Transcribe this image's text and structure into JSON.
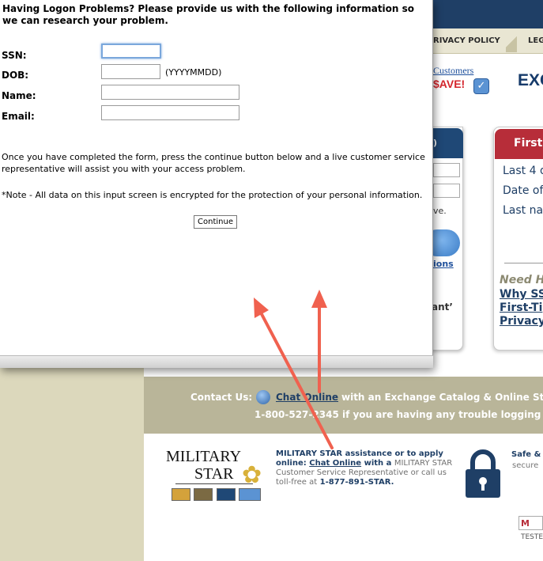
{
  "popup": {
    "heading": "Having Logon Problems? Please provide us with the following information so we can research your problem.",
    "fields": {
      "ssn_label": "SSN:",
      "dob_label": "DOB:",
      "dob_hint": "(YYYYMMDD)",
      "name_label": "Name:",
      "email_label": "Email:",
      "ssn_value": "",
      "dob_value": "",
      "name_value": "",
      "email_value": ""
    },
    "instructions": "Once you have completed the form, press the continue button below and a live customer service representative will assist you with your access problem.",
    "note": "*Note - All data on this input screen is encrypted for the protection of your personal information.",
    "continue_label": "Continue"
  },
  "background_site": {
    "nav": {
      "privacy_policy": "RIVACY POLICY",
      "legal": "LEG"
    },
    "promo": {
      "customers_link": "Customers",
      "save": "$AVE!",
      "exc": "EXC"
    },
    "left_panel": {
      "header_fragment": ")",
      "ve_fragment": "ve.",
      "ions_fragment": "ions",
      "ant_fragment": "ant’"
    },
    "right_panel": {
      "header": "First",
      "line1": "Last 4 d",
      "line2": "Date of",
      "line3": "Last na",
      "need_help": "Need H",
      "why_ssn": "Why SS",
      "first_time": "First-Ti",
      "privacy": "Privacy"
    },
    "contact": {
      "label": "Contact Us:",
      "chat_link": "Chat Online",
      "rest": "with an Exchange Catalog & Online St",
      "phone_line": "1-800-527-2345 if you are having any trouble logging"
    },
    "military_star": {
      "logo_line1": "MILITARY",
      "logo_line2": "STAR",
      "text_prefix": "MILITARY STAR assistance or to apply online: ",
      "chat_link": "Chat Online",
      "text_suffix": " with a",
      "grey_text": "MILITARY STAR Customer Service Representative or call us toll-free at",
      "phone": "1-877-891-STAR."
    },
    "security": {
      "safe": "Safe &",
      "secure": "secure",
      "mcafee": "M",
      "tested": "TESTE"
    }
  },
  "colors": {
    "navy": "#1f3f66",
    "red_header": "#b72d39",
    "arrow": "#f0614f",
    "contact_band": "#b9b599",
    "tan_background": "#dcd8bc"
  },
  "icons": {
    "chat": "chat-globe-icon",
    "check": "checkmark-icon",
    "lock": "padlock-icon",
    "star": "star-flower-icon"
  }
}
